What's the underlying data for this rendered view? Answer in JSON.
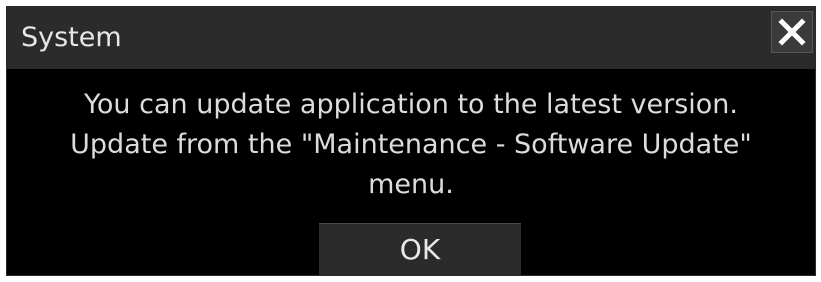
{
  "dialog": {
    "title": "System",
    "close_icon": "close-icon",
    "message_lines": [
      "You can update application to the latest version.",
      "Update from the \"Maintenance - Software Update\"",
      "menu."
    ],
    "ok_label": "OK"
  },
  "colors": {
    "dialog_background": "#000000",
    "titlebar_background": "#2b2b2b",
    "button_background": "#2b2b2b",
    "text": "#dcdcdc",
    "close_glyph": "#ffffff"
  }
}
